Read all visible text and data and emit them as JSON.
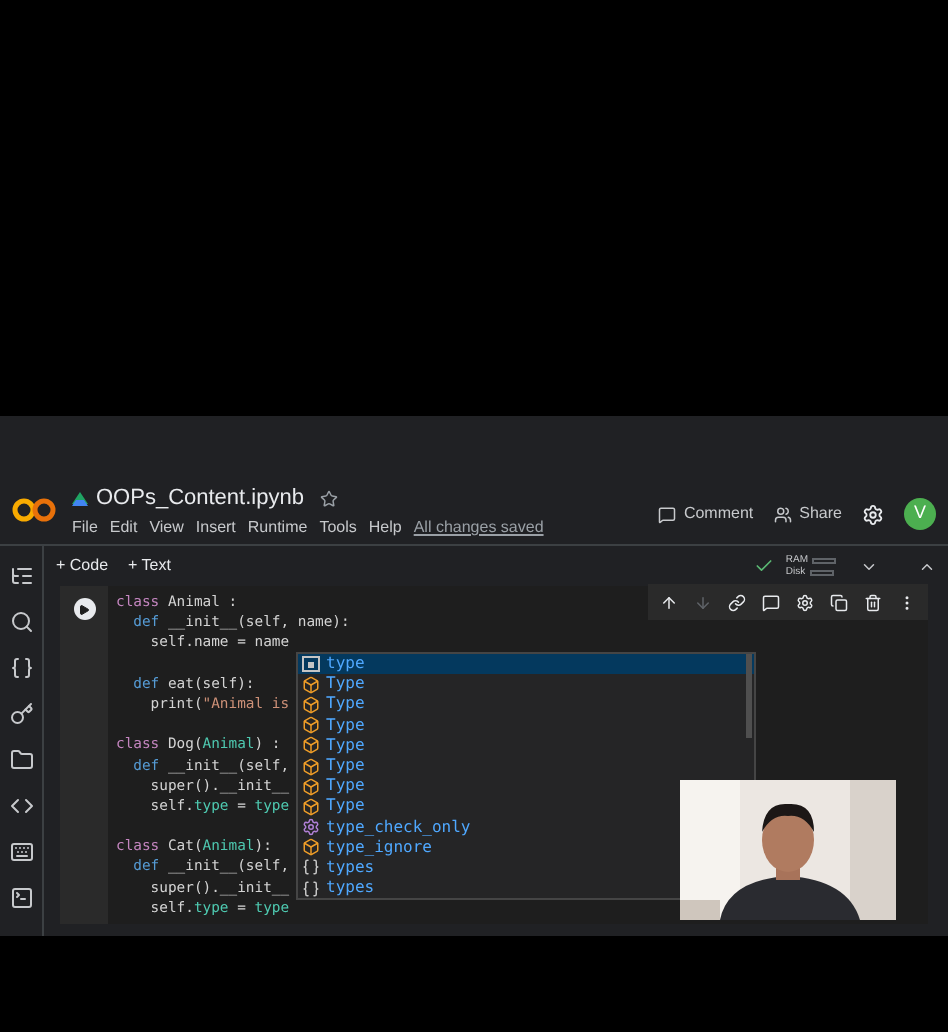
{
  "header": {
    "title": "OOPs_Content.ipynb",
    "menu": [
      "File",
      "Edit",
      "View",
      "Insert",
      "Runtime",
      "Tools",
      "Help"
    ],
    "save_status": "All changes saved",
    "comment": "Comment",
    "share": "Share",
    "avatar": "V"
  },
  "toolbar": {
    "add_buttons": [
      "+ Code",
      "+ Text"
    ],
    "connected": true,
    "ram": "RAM",
    "disk": "Disk"
  },
  "cell_toolbar": [
    {
      "kind": "up",
      "disabled": false
    },
    {
      "kind": "down",
      "disabled": true
    },
    {
      "kind": "link",
      "disabled": false
    },
    {
      "kind": "comment",
      "disabled": false
    },
    {
      "kind": "gear",
      "disabled": false
    },
    {
      "kind": "copy",
      "disabled": false
    },
    {
      "kind": "trash",
      "disabled": false
    },
    {
      "kind": "more",
      "disabled": false
    }
  ],
  "code": [
    {
      "kind": "code",
      "tokens": [
        {
          "text": "class",
          "kind": "keyword"
        },
        {
          "text": " Animal :",
          "kind": "plain"
        }
      ]
    },
    {
      "kind": "code",
      "tokens": [
        {
          "text": "  def",
          "kind": "def"
        },
        {
          "text": " __init__(self, name):",
          "kind": "plain"
        }
      ]
    },
    {
      "kind": "code",
      "tokens": [
        {
          "text": "    self.name = name",
          "kind": "plain"
        }
      ]
    },
    {
      "kind": "blank"
    },
    {
      "kind": "code",
      "tokens": [
        {
          "text": "  def",
          "kind": "def"
        },
        {
          "text": " eat(self):",
          "kind": "plain"
        }
      ]
    },
    {
      "kind": "code",
      "tokens": [
        {
          "text": "    print(",
          "kind": "plain"
        },
        {
          "text": "\"Animal is",
          "kind": "string"
        }
      ]
    },
    {
      "kind": "blank"
    },
    {
      "kind": "code",
      "tokens": [
        {
          "text": "class",
          "kind": "keyword"
        },
        {
          "text": " Dog(",
          "kind": "plain"
        },
        {
          "text": "Animal",
          "kind": "name"
        },
        {
          "text": ") :",
          "kind": "plain"
        }
      ]
    },
    {
      "kind": "code",
      "tokens": [
        {
          "text": "  def",
          "kind": "def"
        },
        {
          "text": " __init__(self,",
          "kind": "plain"
        }
      ]
    },
    {
      "kind": "code",
      "tokens": [
        {
          "text": "    super().__init__",
          "kind": "plain"
        }
      ]
    },
    {
      "kind": "code",
      "tokens": [
        {
          "text": "    self.",
          "kind": "plain"
        },
        {
          "text": "type",
          "kind": "name"
        },
        {
          "text": " = ",
          "kind": "plain"
        },
        {
          "text": "type",
          "kind": "name"
        }
      ]
    },
    {
      "kind": "blank"
    },
    {
      "kind": "code",
      "tokens": [
        {
          "text": "class",
          "kind": "keyword"
        },
        {
          "text": " Cat(",
          "kind": "plain"
        },
        {
          "text": "Animal",
          "kind": "name"
        },
        {
          "text": "):",
          "kind": "plain"
        }
      ]
    },
    {
      "kind": "code",
      "tokens": [
        {
          "text": "  def",
          "kind": "def"
        },
        {
          "text": " __init__(self,",
          "kind": "plain"
        }
      ]
    },
    {
      "kind": "code",
      "tokens": [
        {
          "text": "    super().__init__",
          "kind": "plain"
        }
      ]
    },
    {
      "kind": "code",
      "tokens": [
        {
          "text": "    self.",
          "kind": "plain"
        },
        {
          "text": "type",
          "kind": "name"
        },
        {
          "text": " = ",
          "kind": "plain"
        },
        {
          "text": "type",
          "kind": "name"
        }
      ]
    }
  ],
  "suggestions": [
    {
      "label": "type",
      "kind": "variable",
      "selected": true
    },
    {
      "label": "Type",
      "kind": "class",
      "selected": false
    },
    {
      "label": "Type",
      "kind": "class",
      "selected": false
    },
    {
      "label": "Type",
      "kind": "class",
      "selected": false
    },
    {
      "label": "Type",
      "kind": "class",
      "selected": false
    },
    {
      "label": "Type",
      "kind": "class",
      "selected": false
    },
    {
      "label": "Type",
      "kind": "class",
      "selected": false
    },
    {
      "label": "Type",
      "kind": "class",
      "selected": false
    },
    {
      "label": "type_check_only",
      "kind": "function",
      "selected": false
    },
    {
      "label": "type_ignore",
      "kind": "class",
      "selected": false
    },
    {
      "label": "types",
      "kind": "module",
      "selected": false
    },
    {
      "label": "types",
      "kind": "module",
      "selected": false
    }
  ]
}
